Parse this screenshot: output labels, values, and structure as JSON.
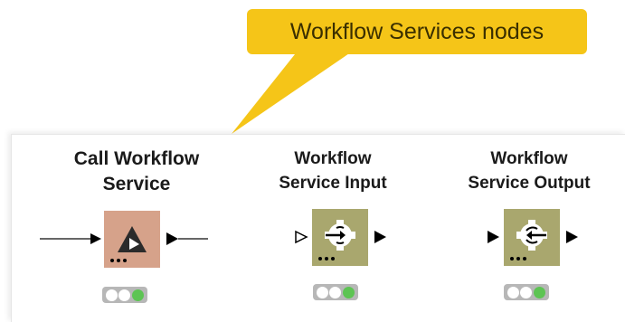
{
  "callout": {
    "label": "Workflow Services nodes"
  },
  "nodes": [
    {
      "title_line1": "Call Workflow",
      "title_line2": "Service",
      "color": "#d6a28a",
      "icon": "play-triangle-icon"
    },
    {
      "title_line1": "Workflow",
      "title_line2": "Service Input",
      "color": "#a9a76e",
      "icon": "service-input-gear-icon"
    },
    {
      "title_line1": "Workflow",
      "title_line2": "Service Output",
      "color": "#a9a76e",
      "icon": "service-output-gear-icon"
    }
  ],
  "colors": {
    "callout": "#f5c518",
    "status_green": "#5dc453",
    "status_gray": "#b7b7b7"
  }
}
